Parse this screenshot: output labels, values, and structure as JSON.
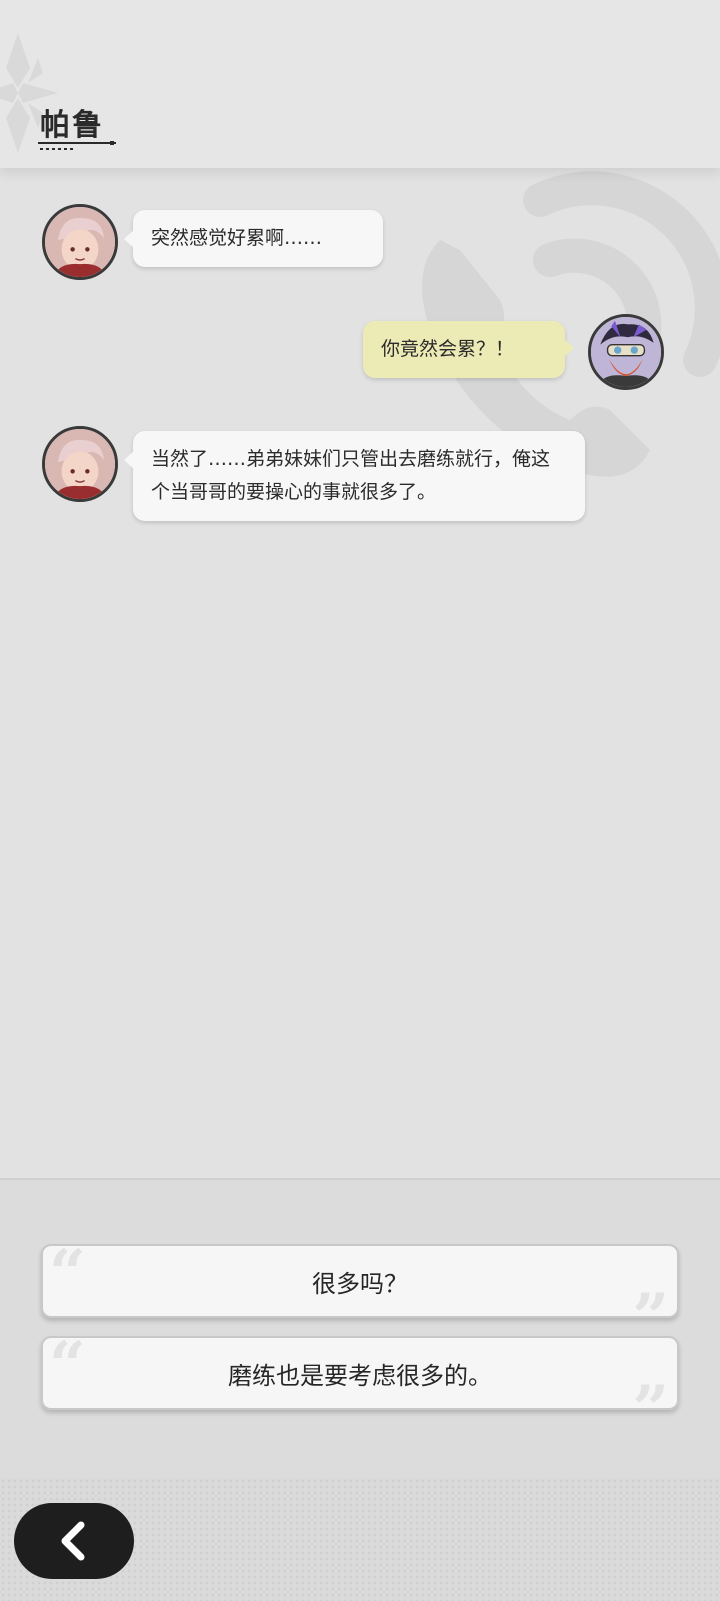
{
  "header": {
    "contact_name": "帕鲁"
  },
  "messages": [
    {
      "side": "left",
      "speaker": "contact",
      "text": "突然感觉好累啊……"
    },
    {
      "side": "right",
      "speaker": "player",
      "text": "你竟然会累？！"
    },
    {
      "side": "left",
      "speaker": "contact",
      "text": "当然了……弟弟妹妹们只管出去磨练就行，俺这个当哥哥的要操心的事就很多了。"
    }
  ],
  "choices": [
    {
      "label": "很多吗？"
    },
    {
      "label": "磨练也是要考虑很多的。"
    }
  ],
  "footer": {
    "back_icon": "chevron-left-icon"
  },
  "colors": {
    "player_bubble": "#ecebb6",
    "contact_bubble": "#f7f7f7",
    "back_button": "#1e1e1e"
  }
}
